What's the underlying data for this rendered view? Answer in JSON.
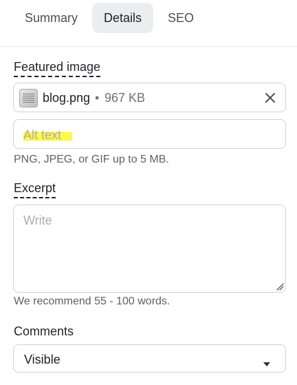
{
  "tabs": [
    {
      "label": "Summary",
      "active": false
    },
    {
      "label": "Details",
      "active": true
    },
    {
      "label": "SEO",
      "active": false
    }
  ],
  "featured_image": {
    "heading": "Featured image",
    "file": {
      "name": "blog.png",
      "separator": "•",
      "size": "967 KB"
    },
    "alt_placeholder": "Alt text",
    "help": "PNG, JPEG, or GIF up to 5 MB."
  },
  "excerpt": {
    "heading": "Excerpt",
    "placeholder": "Write",
    "help": "We recommend 55 - 100 words."
  },
  "comments": {
    "label": "Comments",
    "selected": "Visible"
  },
  "colors": {
    "highlight": "#fff84a",
    "active_tab_bg": "#ecedef",
    "border": "#cfd2d6"
  },
  "icons": {
    "clear": "close-icon",
    "resize": "resize-handle-icon",
    "dropdown": "caret-down-icon"
  }
}
